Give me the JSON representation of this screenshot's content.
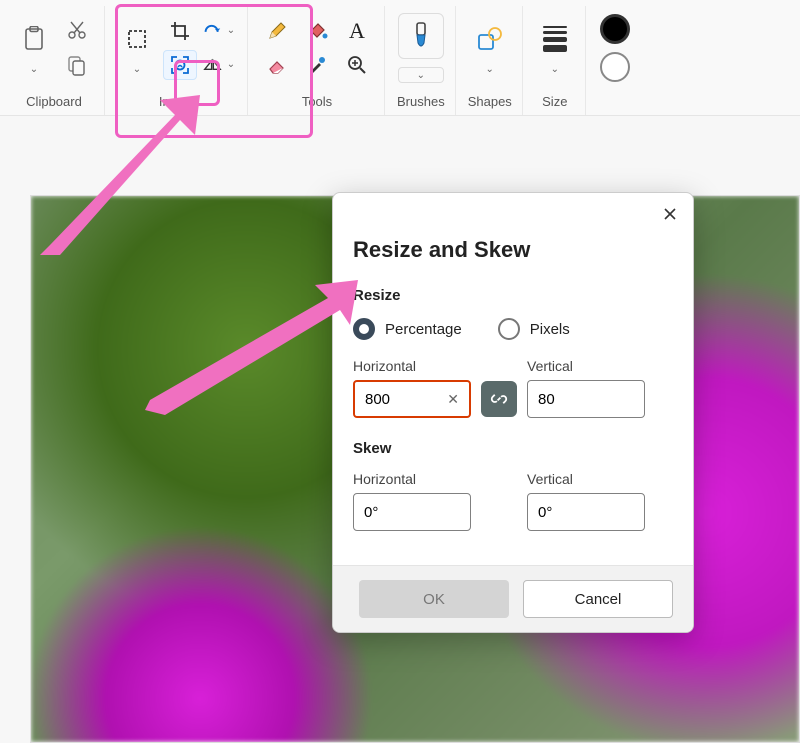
{
  "ribbon": {
    "clipboard_label": "Clipboard",
    "image_label": "Image",
    "tools_label": "Tools",
    "brushes_label": "Brushes",
    "shapes_label": "Shapes",
    "size_label": "Size"
  },
  "dialog": {
    "title": "Resize and Skew",
    "resize_label": "Resize",
    "percentage_label": "Percentage",
    "pixels_label": "Pixels",
    "horizontal_label": "Horizontal",
    "vertical_label": "Vertical",
    "horizontal_value": "800",
    "vertical_value": "80",
    "skew_label": "Skew",
    "skew_h_value": "0°",
    "skew_v_value": "0°",
    "ok_label": "OK",
    "cancel_label": "Cancel"
  },
  "annotation": {
    "highlight_color": "#ef5fc2"
  }
}
